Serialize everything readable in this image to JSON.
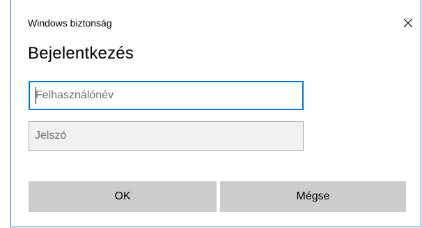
{
  "window": {
    "caption": "Windows biztonság",
    "title": "Bejelentkezés",
    "close_icon": "close-icon"
  },
  "form": {
    "username": {
      "value": "",
      "placeholder": "Felhasználónév"
    },
    "password": {
      "value": "",
      "placeholder": "Jelszó"
    }
  },
  "buttons": {
    "ok_label": "OK",
    "cancel_label": "Mégse"
  },
  "colors": {
    "focus_border": "#0078d7",
    "window_border": "#2b78d4",
    "button_bg": "#cccccc"
  }
}
